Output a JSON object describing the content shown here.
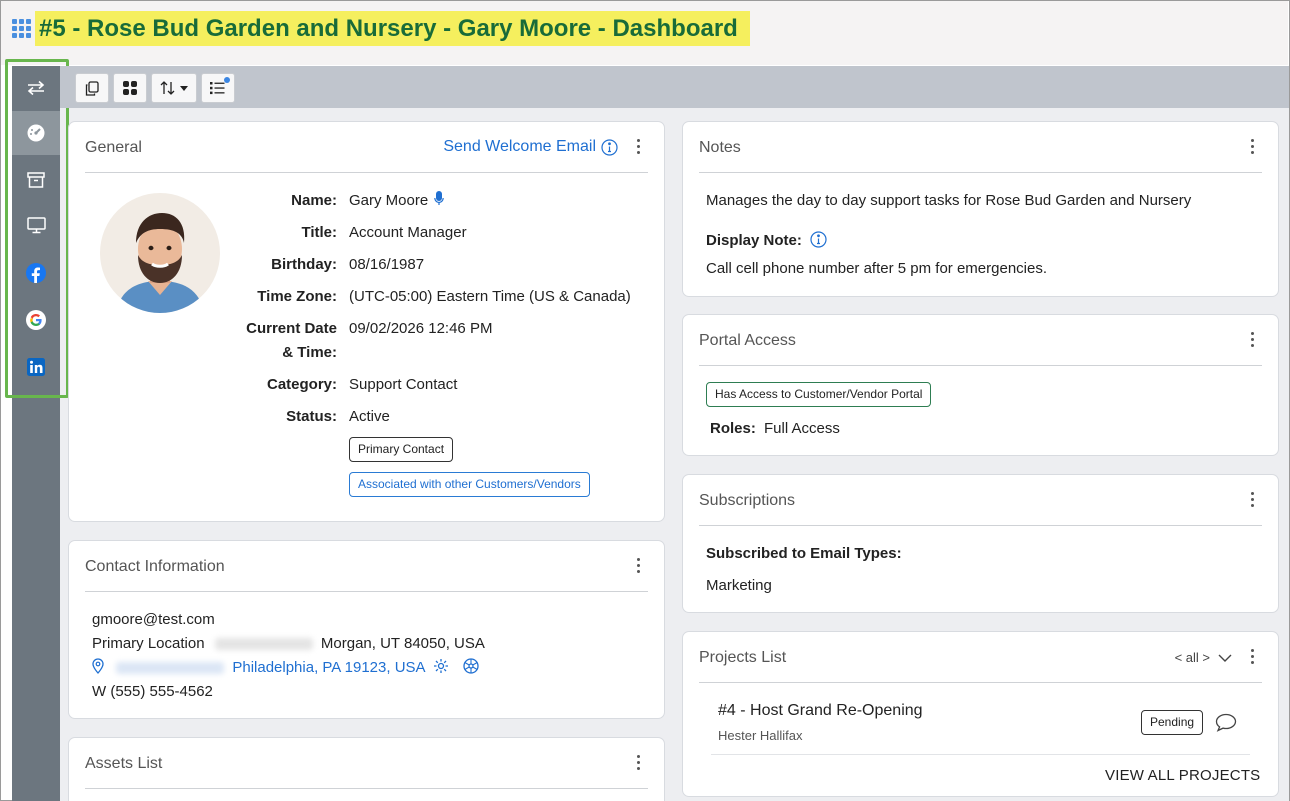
{
  "page": {
    "title": "#5 - Rose Bud Garden and Nursery - Gary Moore - Dashboard"
  },
  "colors": {
    "accent": "#1f6fd1",
    "highlight": "#f5ef5e",
    "title_text": "#186b39",
    "sidebar": "#6c767f",
    "sidebar_outline": "#68b64d"
  },
  "sidebar": {
    "items": [
      {
        "icon": "swap-arrows-icon",
        "active": false
      },
      {
        "icon": "dashboard-gauge-icon",
        "active": true
      },
      {
        "icon": "archive-box-icon",
        "active": false
      },
      {
        "icon": "monitor-icon",
        "active": false
      },
      {
        "icon": "facebook-icon",
        "active": false
      },
      {
        "icon": "google-icon",
        "active": false
      },
      {
        "icon": "linkedin-icon",
        "active": false
      }
    ]
  },
  "toolbar": {
    "buttons": [
      {
        "icon": "copy-icon"
      },
      {
        "icon": "widgets-grid-icon"
      },
      {
        "icon": "sort-arrows-icon",
        "has_dropdown": true
      },
      {
        "icon": "list-settings-icon",
        "badge": true
      }
    ]
  },
  "general": {
    "title": "General",
    "action_link": "Send Welcome Email",
    "fields": {
      "name_label": "Name:",
      "name_value": "Gary Moore",
      "title_label": "Title:",
      "title_value": "Account Manager",
      "birthday_label": "Birthday:",
      "birthday_value": "08/16/1987",
      "timezone_label": "Time Zone:",
      "timezone_value": "(UTC-05:00) Eastern Time (US & Canada)",
      "datetime_label_1": "Current Date",
      "datetime_label_2": "& Time:",
      "datetime_value": "09/02/2026 12:46 PM",
      "category_label": "Category:",
      "category_value": "Support Contact",
      "status_label": "Status:",
      "status_value": "Active"
    },
    "chips": {
      "primary": "Primary Contact",
      "associated": "Associated with other Customers/Vendors"
    }
  },
  "contact": {
    "title": "Contact Information",
    "email": "gmoore@test.com",
    "primary_location_label": "Primary Location",
    "primary_location_address": "Morgan, UT 84050, USA",
    "secondary_address": "Philadelphia, PA 19123, USA",
    "phone": "W (555) 555-4562"
  },
  "assets": {
    "title": "Assets List"
  },
  "notes": {
    "title": "Notes",
    "text": "Manages the day to day support tasks for Rose Bud Garden and Nursery",
    "display_note_label": "Display Note:",
    "display_note_text": "Call cell phone number after 5 pm for emergencies."
  },
  "portal": {
    "title": "Portal Access",
    "chip": "Has Access to Customer/Vendor Portal",
    "roles_label": "Roles:",
    "roles_value": "Full Access"
  },
  "subscriptions": {
    "title": "Subscriptions",
    "label": "Subscribed to Email Types:",
    "value": "Marketing"
  },
  "projects": {
    "title": "Projects List",
    "filter": "< all >",
    "items": [
      {
        "name": "#4 - Host Grand Re-Opening",
        "person": "Hester Hallifax",
        "status": "Pending"
      }
    ],
    "view_all": "VIEW ALL PROJECTS"
  }
}
